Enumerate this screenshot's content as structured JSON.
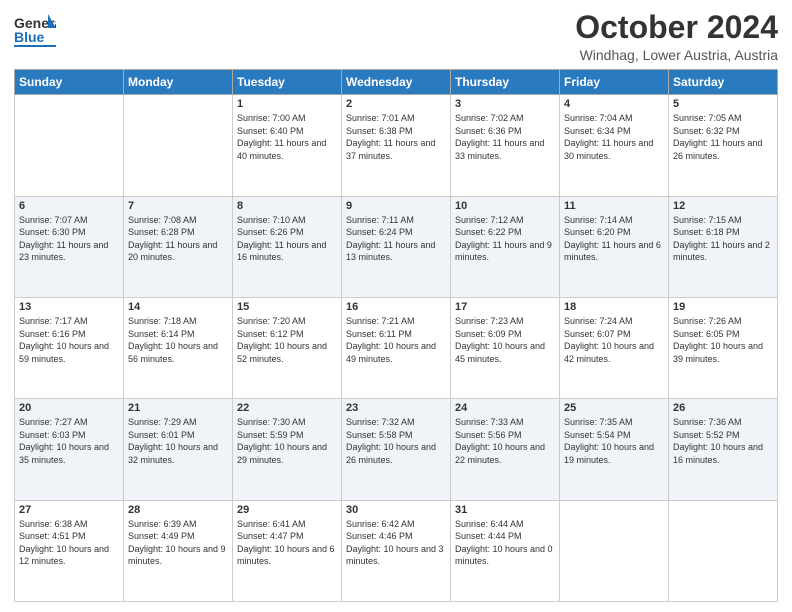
{
  "header": {
    "logo_general": "General",
    "logo_blue": "Blue",
    "month_title": "October 2024",
    "location": "Windhag, Lower Austria, Austria"
  },
  "weekdays": [
    "Sunday",
    "Monday",
    "Tuesday",
    "Wednesday",
    "Thursday",
    "Friday",
    "Saturday"
  ],
  "weeks": [
    [
      {
        "day": "",
        "sunrise": "",
        "sunset": "",
        "daylight": ""
      },
      {
        "day": "",
        "sunrise": "",
        "sunset": "",
        "daylight": ""
      },
      {
        "day": "1",
        "sunrise": "Sunrise: 7:00 AM",
        "sunset": "Sunset: 6:40 PM",
        "daylight": "Daylight: 11 hours and 40 minutes."
      },
      {
        "day": "2",
        "sunrise": "Sunrise: 7:01 AM",
        "sunset": "Sunset: 6:38 PM",
        "daylight": "Daylight: 11 hours and 37 minutes."
      },
      {
        "day": "3",
        "sunrise": "Sunrise: 7:02 AM",
        "sunset": "Sunset: 6:36 PM",
        "daylight": "Daylight: 11 hours and 33 minutes."
      },
      {
        "day": "4",
        "sunrise": "Sunrise: 7:04 AM",
        "sunset": "Sunset: 6:34 PM",
        "daylight": "Daylight: 11 hours and 30 minutes."
      },
      {
        "day": "5",
        "sunrise": "Sunrise: 7:05 AM",
        "sunset": "Sunset: 6:32 PM",
        "daylight": "Daylight: 11 hours and 26 minutes."
      }
    ],
    [
      {
        "day": "6",
        "sunrise": "Sunrise: 7:07 AM",
        "sunset": "Sunset: 6:30 PM",
        "daylight": "Daylight: 11 hours and 23 minutes."
      },
      {
        "day": "7",
        "sunrise": "Sunrise: 7:08 AM",
        "sunset": "Sunset: 6:28 PM",
        "daylight": "Daylight: 11 hours and 20 minutes."
      },
      {
        "day": "8",
        "sunrise": "Sunrise: 7:10 AM",
        "sunset": "Sunset: 6:26 PM",
        "daylight": "Daylight: 11 hours and 16 minutes."
      },
      {
        "day": "9",
        "sunrise": "Sunrise: 7:11 AM",
        "sunset": "Sunset: 6:24 PM",
        "daylight": "Daylight: 11 hours and 13 minutes."
      },
      {
        "day": "10",
        "sunrise": "Sunrise: 7:12 AM",
        "sunset": "Sunset: 6:22 PM",
        "daylight": "Daylight: 11 hours and 9 minutes."
      },
      {
        "day": "11",
        "sunrise": "Sunrise: 7:14 AM",
        "sunset": "Sunset: 6:20 PM",
        "daylight": "Daylight: 11 hours and 6 minutes."
      },
      {
        "day": "12",
        "sunrise": "Sunrise: 7:15 AM",
        "sunset": "Sunset: 6:18 PM",
        "daylight": "Daylight: 11 hours and 2 minutes."
      }
    ],
    [
      {
        "day": "13",
        "sunrise": "Sunrise: 7:17 AM",
        "sunset": "Sunset: 6:16 PM",
        "daylight": "Daylight: 10 hours and 59 minutes."
      },
      {
        "day": "14",
        "sunrise": "Sunrise: 7:18 AM",
        "sunset": "Sunset: 6:14 PM",
        "daylight": "Daylight: 10 hours and 56 minutes."
      },
      {
        "day": "15",
        "sunrise": "Sunrise: 7:20 AM",
        "sunset": "Sunset: 6:12 PM",
        "daylight": "Daylight: 10 hours and 52 minutes."
      },
      {
        "day": "16",
        "sunrise": "Sunrise: 7:21 AM",
        "sunset": "Sunset: 6:11 PM",
        "daylight": "Daylight: 10 hours and 49 minutes."
      },
      {
        "day": "17",
        "sunrise": "Sunrise: 7:23 AM",
        "sunset": "Sunset: 6:09 PM",
        "daylight": "Daylight: 10 hours and 45 minutes."
      },
      {
        "day": "18",
        "sunrise": "Sunrise: 7:24 AM",
        "sunset": "Sunset: 6:07 PM",
        "daylight": "Daylight: 10 hours and 42 minutes."
      },
      {
        "day": "19",
        "sunrise": "Sunrise: 7:26 AM",
        "sunset": "Sunset: 6:05 PM",
        "daylight": "Daylight: 10 hours and 39 minutes."
      }
    ],
    [
      {
        "day": "20",
        "sunrise": "Sunrise: 7:27 AM",
        "sunset": "Sunset: 6:03 PM",
        "daylight": "Daylight: 10 hours and 35 minutes."
      },
      {
        "day": "21",
        "sunrise": "Sunrise: 7:29 AM",
        "sunset": "Sunset: 6:01 PM",
        "daylight": "Daylight: 10 hours and 32 minutes."
      },
      {
        "day": "22",
        "sunrise": "Sunrise: 7:30 AM",
        "sunset": "Sunset: 5:59 PM",
        "daylight": "Daylight: 10 hours and 29 minutes."
      },
      {
        "day": "23",
        "sunrise": "Sunrise: 7:32 AM",
        "sunset": "Sunset: 5:58 PM",
        "daylight": "Daylight: 10 hours and 26 minutes."
      },
      {
        "day": "24",
        "sunrise": "Sunrise: 7:33 AM",
        "sunset": "Sunset: 5:56 PM",
        "daylight": "Daylight: 10 hours and 22 minutes."
      },
      {
        "day": "25",
        "sunrise": "Sunrise: 7:35 AM",
        "sunset": "Sunset: 5:54 PM",
        "daylight": "Daylight: 10 hours and 19 minutes."
      },
      {
        "day": "26",
        "sunrise": "Sunrise: 7:36 AM",
        "sunset": "Sunset: 5:52 PM",
        "daylight": "Daylight: 10 hours and 16 minutes."
      }
    ],
    [
      {
        "day": "27",
        "sunrise": "Sunrise: 6:38 AM",
        "sunset": "Sunset: 4:51 PM",
        "daylight": "Daylight: 10 hours and 12 minutes."
      },
      {
        "day": "28",
        "sunrise": "Sunrise: 6:39 AM",
        "sunset": "Sunset: 4:49 PM",
        "daylight": "Daylight: 10 hours and 9 minutes."
      },
      {
        "day": "29",
        "sunrise": "Sunrise: 6:41 AM",
        "sunset": "Sunset: 4:47 PM",
        "daylight": "Daylight: 10 hours and 6 minutes."
      },
      {
        "day": "30",
        "sunrise": "Sunrise: 6:42 AM",
        "sunset": "Sunset: 4:46 PM",
        "daylight": "Daylight: 10 hours and 3 minutes."
      },
      {
        "day": "31",
        "sunrise": "Sunrise: 6:44 AM",
        "sunset": "Sunset: 4:44 PM",
        "daylight": "Daylight: 10 hours and 0 minutes."
      },
      {
        "day": "",
        "sunrise": "",
        "sunset": "",
        "daylight": ""
      },
      {
        "day": "",
        "sunrise": "",
        "sunset": "",
        "daylight": ""
      }
    ]
  ]
}
